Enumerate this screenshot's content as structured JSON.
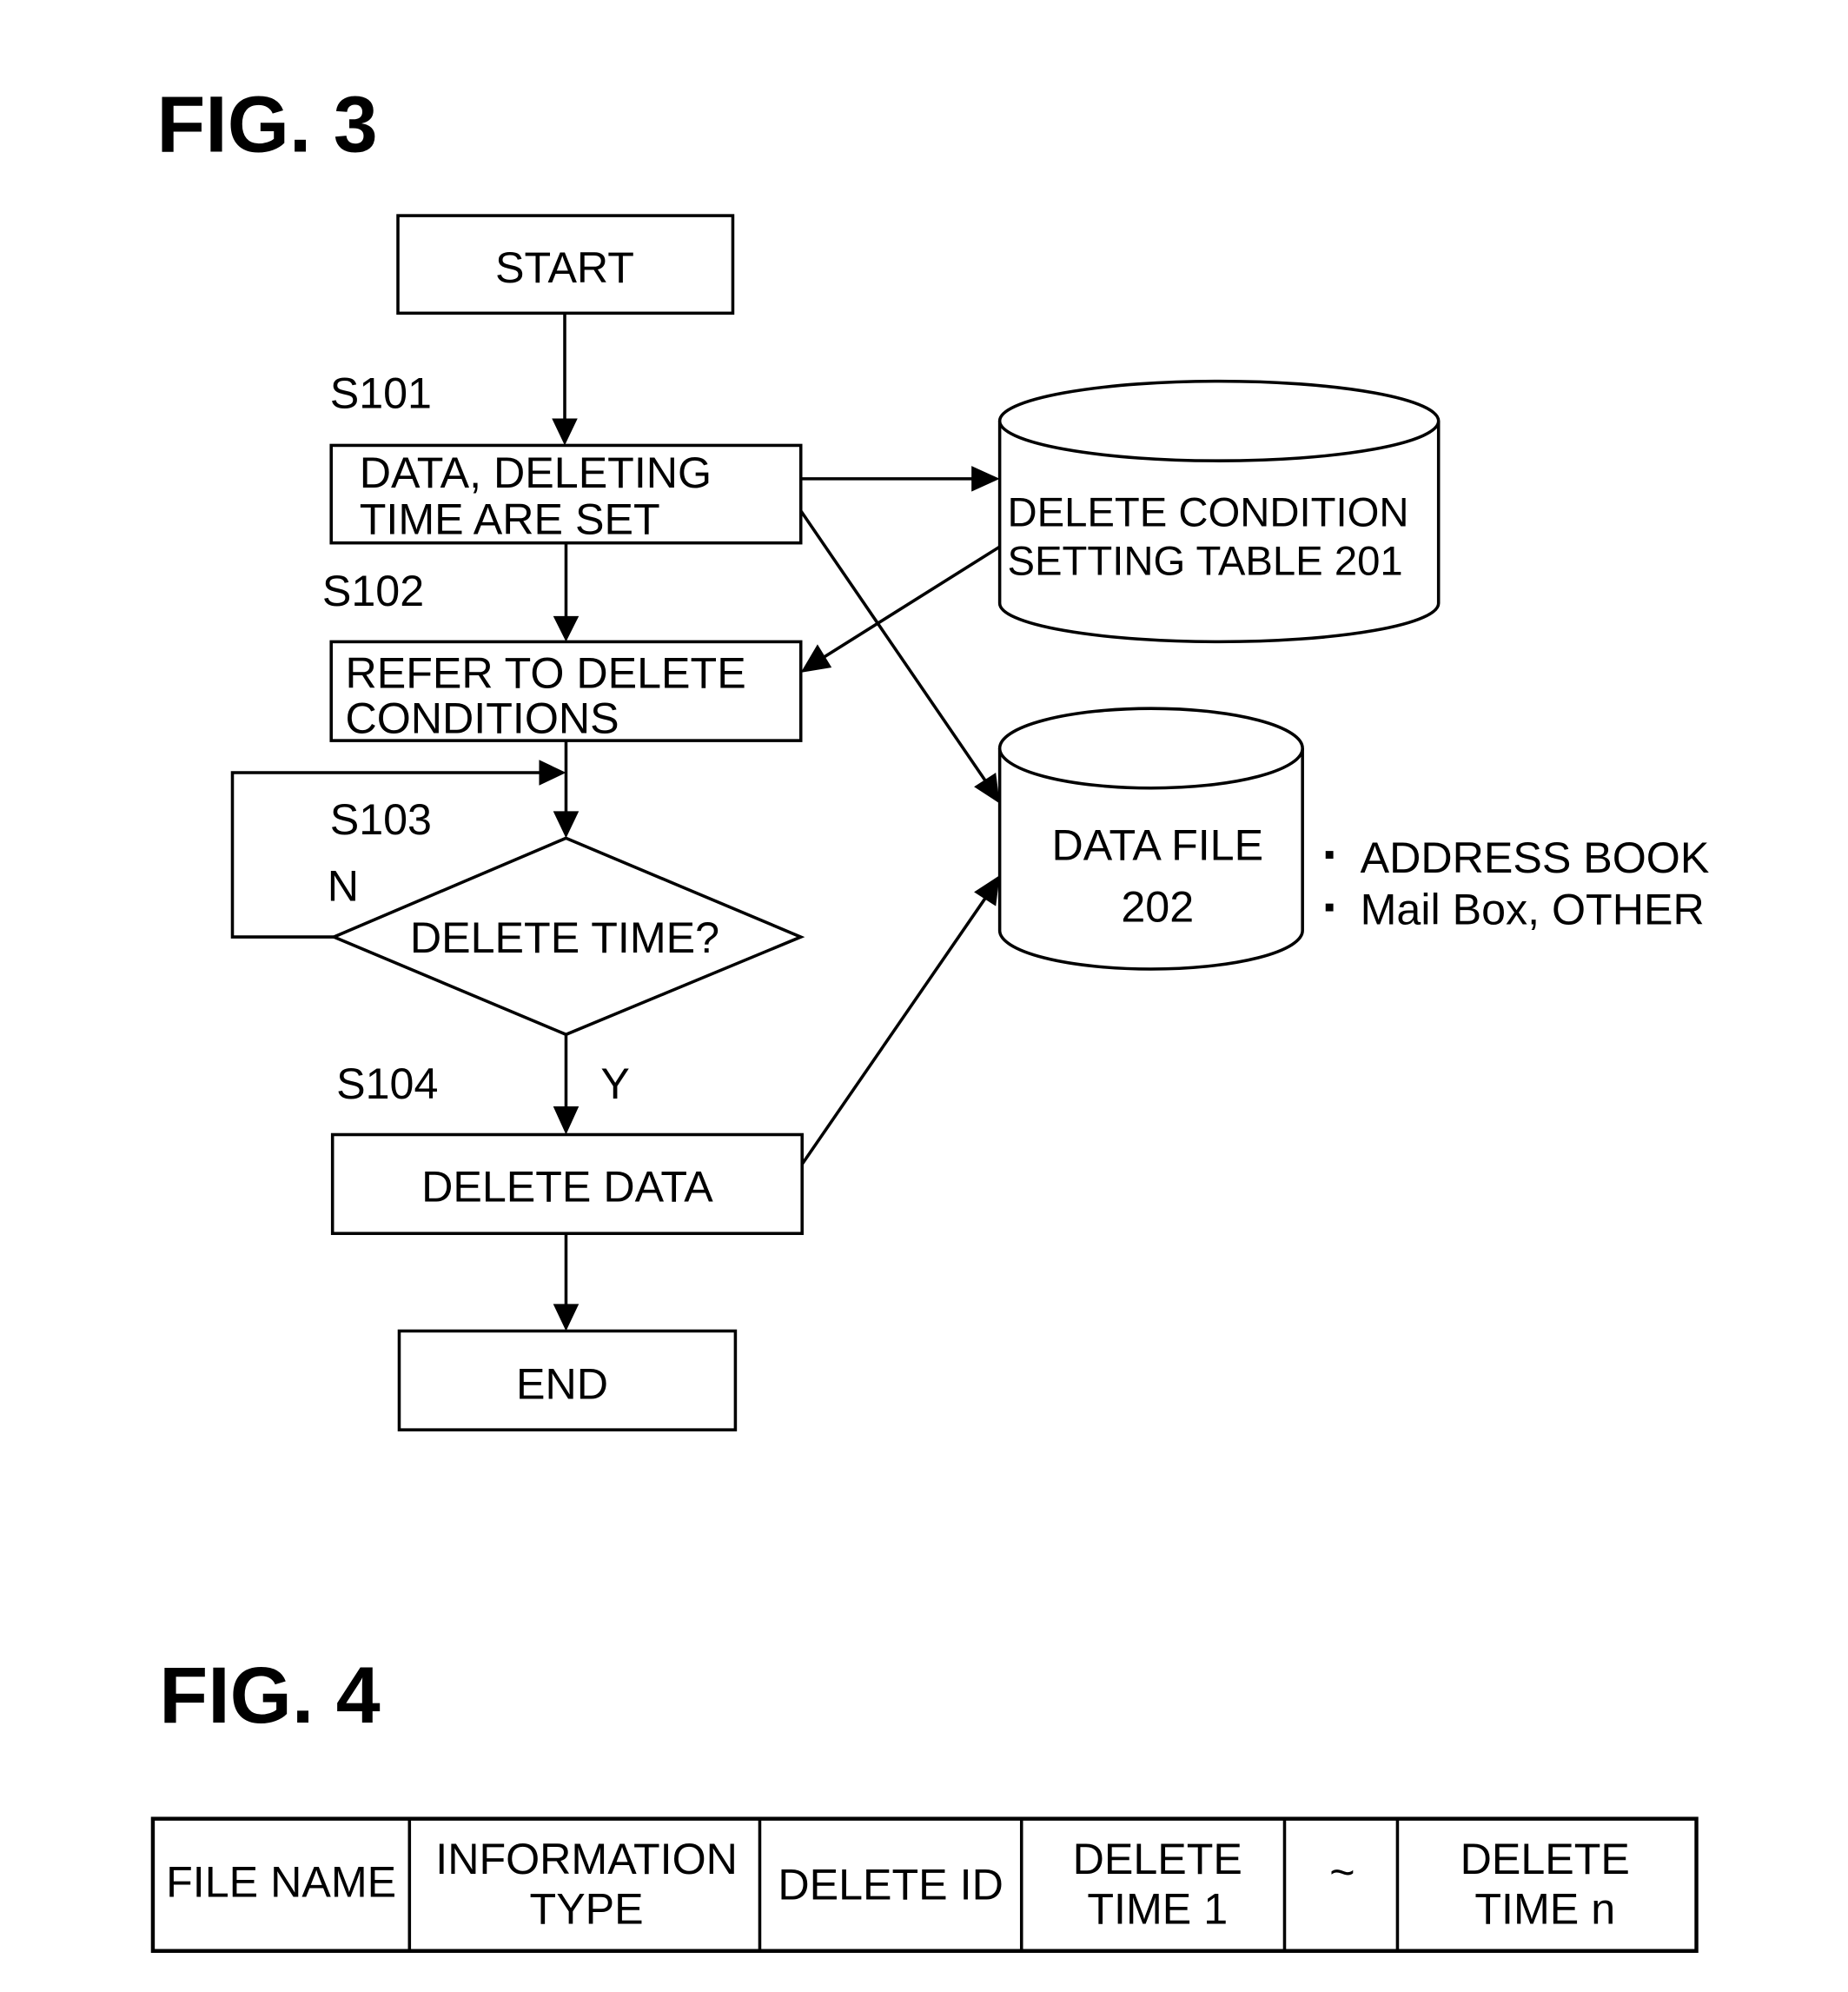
{
  "fig3": {
    "title": "FIG. 3",
    "start": "START",
    "end": "END",
    "steps": {
      "s101": {
        "id": "S101",
        "line1": "DATA, DELETING",
        "line2": "TIME ARE SET"
      },
      "s102": {
        "id": "S102",
        "line1": "REFER TO DELETE",
        "line2": "CONDITIONS"
      },
      "s103": {
        "id": "S103",
        "text": "DELETE TIME?",
        "no": "N",
        "yes": "Y"
      },
      "s104": {
        "id": "S104",
        "text": "DELETE DATA"
      }
    },
    "stores": {
      "table": {
        "line1": "DELETE CONDITION",
        "line2": "SETTING TABLE  201"
      },
      "data_file": {
        "line1": "DATA FILE",
        "line2": "202"
      }
    },
    "data_file_contents": [
      "ADDRESS BOOK",
      "Mail Box, OTHER"
    ]
  },
  "fig4": {
    "title": "FIG. 4",
    "columns": [
      {
        "line1": "FILE NAME",
        "line2": ""
      },
      {
        "line1": "INFORMATION",
        "line2": "TYPE"
      },
      {
        "line1": "DELETE ID",
        "line2": ""
      },
      {
        "line1": "DELETE",
        "line2": "TIME 1"
      },
      {
        "line1": "~",
        "line2": ""
      },
      {
        "line1": "DELETE",
        "line2": "TIME n"
      }
    ]
  }
}
